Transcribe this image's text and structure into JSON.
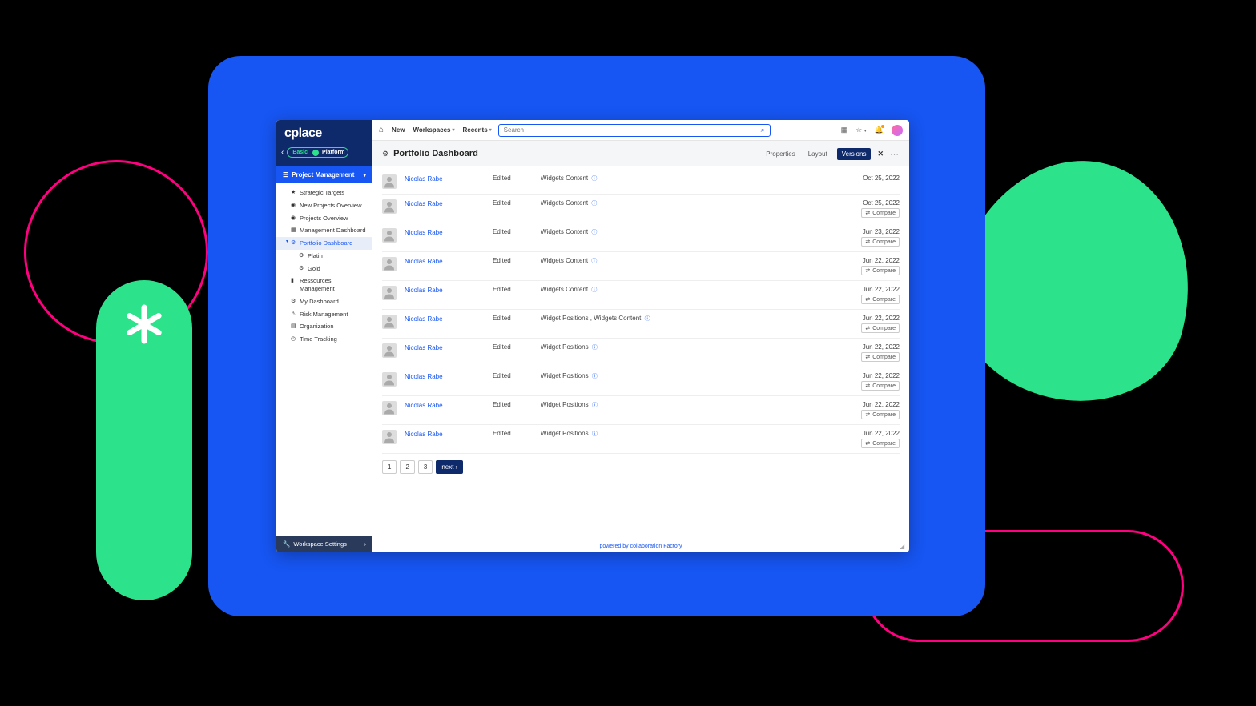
{
  "app": {
    "logo": "cplace",
    "mode_basic": "Basic",
    "mode_platform": "Platform"
  },
  "workspace": {
    "name": "Project Management"
  },
  "sidebar": {
    "items": [
      {
        "label": "Strategic Targets",
        "icon": "★"
      },
      {
        "label": "New Projects Overview",
        "icon": "◉"
      },
      {
        "label": "Projects Overview",
        "icon": "◉"
      },
      {
        "label": "Management Dashboard",
        "icon": "▦"
      },
      {
        "label": "Portfolio Dashboard",
        "icon": "⚙"
      },
      {
        "label": "Platin",
        "icon": "⚙"
      },
      {
        "label": "Gold",
        "icon": "⚙"
      },
      {
        "label": "Ressources Management",
        "icon": "▮"
      },
      {
        "label": "My Dashboard",
        "icon": "⚙"
      },
      {
        "label": "Risk Management",
        "icon": "⚠"
      },
      {
        "label": "Organization",
        "icon": "▤"
      },
      {
        "label": "Time Tracking",
        "icon": "◷"
      }
    ],
    "footer": "Workspace Settings"
  },
  "topbar": {
    "new": "New",
    "workspaces": "Workspaces",
    "recents": "Recents",
    "search_placeholder": "Search"
  },
  "page": {
    "title": "Portfolio Dashboard",
    "tabs": {
      "properties": "Properties",
      "layout": "Layout",
      "versions": "Versions"
    }
  },
  "versions": [
    {
      "user": "Nicolas Rabe",
      "action": "Edited",
      "desc": "Widgets Content",
      "date": "Oct 25, 2022",
      "compare": false
    },
    {
      "user": "Nicolas Rabe",
      "action": "Edited",
      "desc": "Widgets Content",
      "date": "Oct 25, 2022",
      "compare": true
    },
    {
      "user": "Nicolas Rabe",
      "action": "Edited",
      "desc": "Widgets Content",
      "date": "Jun 23, 2022",
      "compare": true
    },
    {
      "user": "Nicolas Rabe",
      "action": "Edited",
      "desc": "Widgets Content",
      "date": "Jun 22, 2022",
      "compare": true
    },
    {
      "user": "Nicolas Rabe",
      "action": "Edited",
      "desc": "Widgets Content",
      "date": "Jun 22, 2022",
      "compare": true
    },
    {
      "user": "Nicolas Rabe",
      "action": "Edited",
      "desc": "Widget Positions , Widgets Content",
      "date": "Jun 22, 2022",
      "compare": true
    },
    {
      "user": "Nicolas Rabe",
      "action": "Edited",
      "desc": "Widget Positions",
      "date": "Jun 22, 2022",
      "compare": true
    },
    {
      "user": "Nicolas Rabe",
      "action": "Edited",
      "desc": "Widget Positions",
      "date": "Jun 22, 2022",
      "compare": true
    },
    {
      "user": "Nicolas Rabe",
      "action": "Edited",
      "desc": "Widget Positions",
      "date": "Jun 22, 2022",
      "compare": true
    },
    {
      "user": "Nicolas Rabe",
      "action": "Edited",
      "desc": "Widget Positions",
      "date": "Jun 22, 2022",
      "compare": true
    }
  ],
  "compare_label": "Compare",
  "pagination": {
    "p1": "1",
    "p2": "2",
    "p3": "3",
    "next": "next"
  },
  "footer": "powered by collaboration Factory"
}
